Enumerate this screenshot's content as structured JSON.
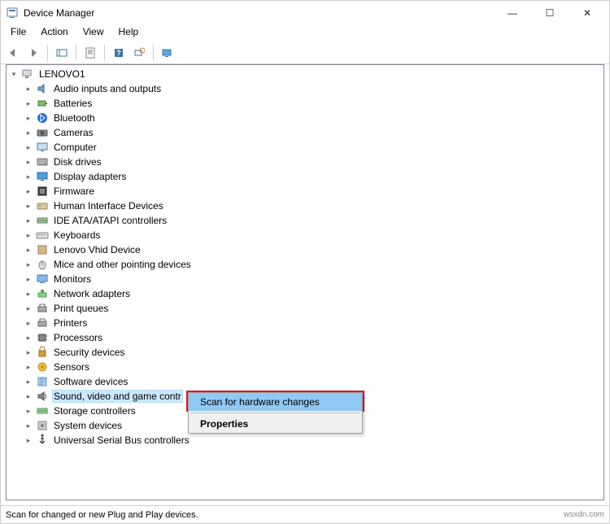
{
  "window": {
    "title": "Device Manager",
    "minimize": "—",
    "maximize": "☐",
    "close": "✕"
  },
  "menubar": [
    "File",
    "Action",
    "View",
    "Help"
  ],
  "status": "Scan for changed or new Plug and Play devices.",
  "watermark": "wsxdn.com",
  "root": {
    "label": "LENOVO1",
    "items": [
      {
        "label": "Audio inputs and outputs",
        "icon": "audio"
      },
      {
        "label": "Batteries",
        "icon": "battery"
      },
      {
        "label": "Bluetooth",
        "icon": "bluetooth"
      },
      {
        "label": "Cameras",
        "icon": "camera"
      },
      {
        "label": "Computer",
        "icon": "computer"
      },
      {
        "label": "Disk drives",
        "icon": "disk"
      },
      {
        "label": "Display adapters",
        "icon": "display"
      },
      {
        "label": "Firmware",
        "icon": "firmware"
      },
      {
        "label": "Human Interface Devices",
        "icon": "hid"
      },
      {
        "label": "IDE ATA/ATAPI controllers",
        "icon": "ide"
      },
      {
        "label": "Keyboards",
        "icon": "keyboard"
      },
      {
        "label": "Lenovo Vhid Device",
        "icon": "vhid"
      },
      {
        "label": "Mice and other pointing devices",
        "icon": "mouse"
      },
      {
        "label": "Monitors",
        "icon": "monitor"
      },
      {
        "label": "Network adapters",
        "icon": "network"
      },
      {
        "label": "Print queues",
        "icon": "printer"
      },
      {
        "label": "Printers",
        "icon": "printer"
      },
      {
        "label": "Processors",
        "icon": "cpu"
      },
      {
        "label": "Security devices",
        "icon": "security"
      },
      {
        "label": "Sensors",
        "icon": "sensor"
      },
      {
        "label": "Software devices",
        "icon": "software"
      },
      {
        "label": "Sound, video and game controllers",
        "icon": "sound",
        "selected": true
      },
      {
        "label": "Storage controllers",
        "icon": "storage"
      },
      {
        "label": "System devices",
        "icon": "system"
      },
      {
        "label": "Universal Serial Bus controllers",
        "icon": "usb"
      }
    ]
  },
  "context": {
    "scan": "Scan for hardware changes",
    "properties": "Properties"
  }
}
